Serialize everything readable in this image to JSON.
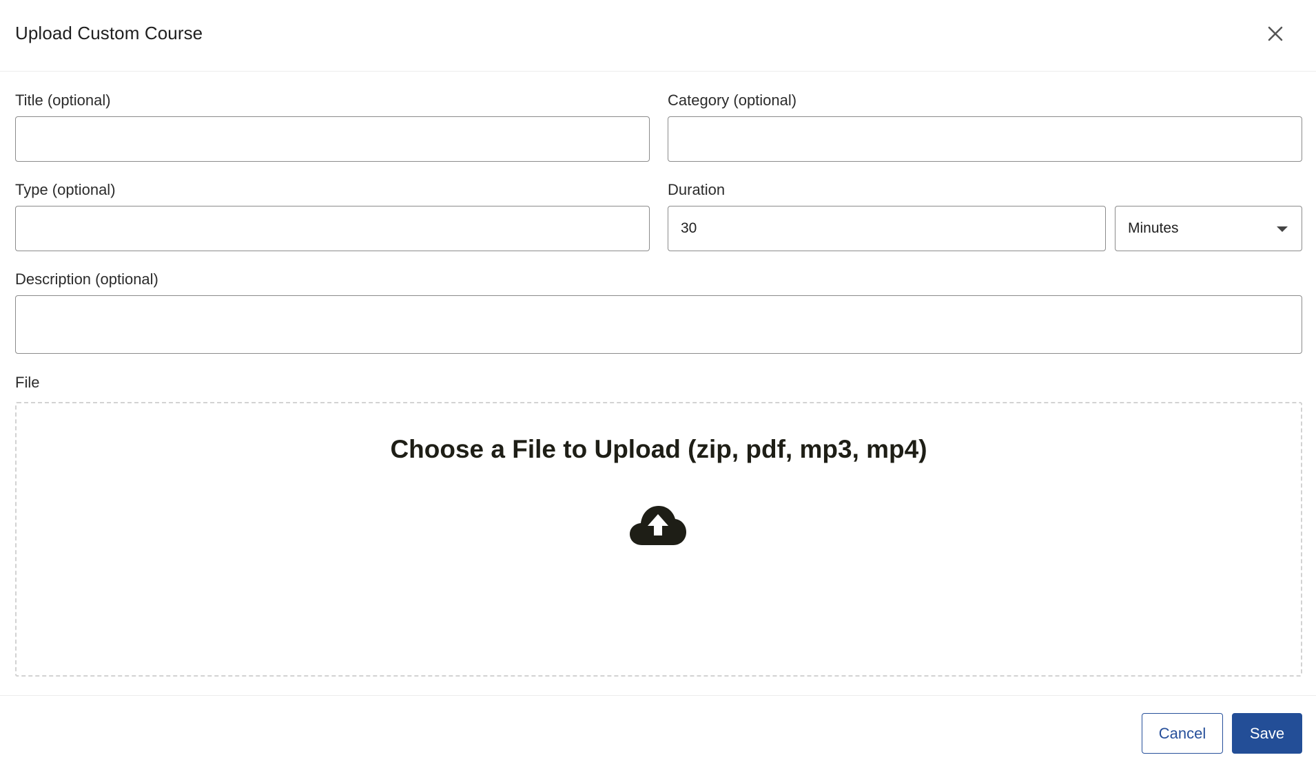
{
  "dialog": {
    "title": "Upload Custom Course",
    "close_icon": "close-icon"
  },
  "form": {
    "title": {
      "label": "Title (optional)",
      "value": "",
      "placeholder": ""
    },
    "category": {
      "label": "Category (optional)",
      "value": "",
      "placeholder": ""
    },
    "type": {
      "label": "Type (optional)",
      "value": "",
      "placeholder": ""
    },
    "duration": {
      "label": "Duration",
      "value": "30",
      "unit": "Minutes"
    },
    "description": {
      "label": "Description (optional)",
      "value": "",
      "placeholder": ""
    },
    "file": {
      "label": "File",
      "dropzone_text": "Choose a File to Upload (zip, pdf, mp3, mp4)",
      "icon": "cloud-upload-icon"
    }
  },
  "footer": {
    "cancel_label": "Cancel",
    "save_label": "Save"
  },
  "colors": {
    "primary": "#234e97",
    "border": "#8a8a8a",
    "dropzone_border": "#d2d2d2",
    "text": "#1f1f1f"
  }
}
